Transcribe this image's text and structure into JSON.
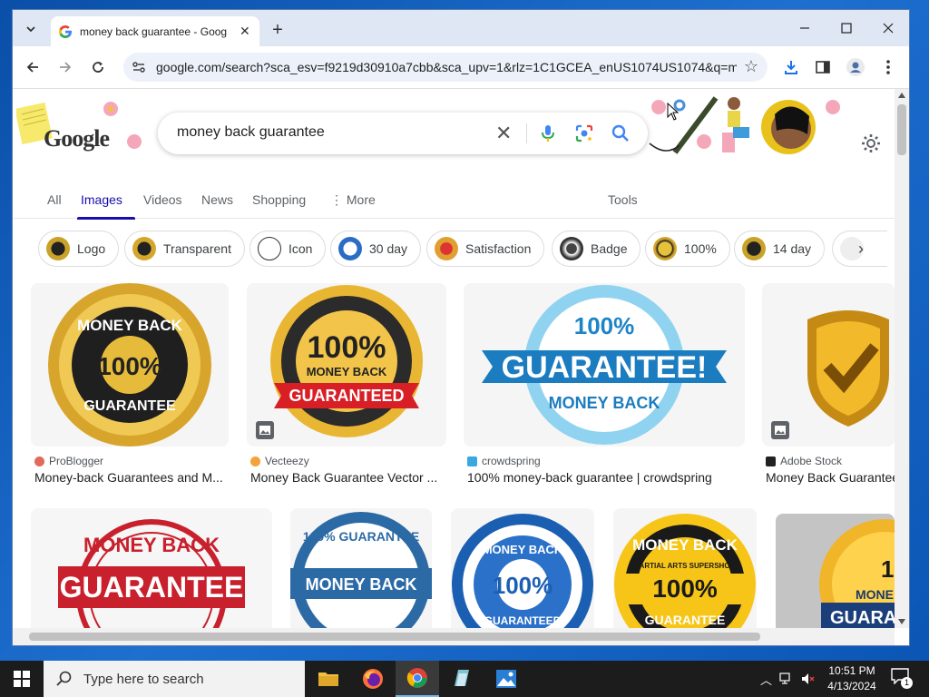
{
  "browser": {
    "tab_title": "money back guarantee - Goog",
    "url": "google.com/search?sca_esv=f9219d30910a7cbb&sca_upv=1&rlz=1C1GCEA_enUS1074US1074&q=m..."
  },
  "google": {
    "logo_text": "Google",
    "query": "money back guarantee",
    "tabs": [
      {
        "label": "All"
      },
      {
        "label": "Images"
      },
      {
        "label": "Videos"
      },
      {
        "label": "News"
      },
      {
        "label": "Shopping"
      },
      {
        "label": "More"
      }
    ],
    "tools_label": "Tools",
    "chips": [
      {
        "label": "Logo"
      },
      {
        "label": "Transparent"
      },
      {
        "label": "Icon"
      },
      {
        "label": "30 day"
      },
      {
        "label": "Satisfaction"
      },
      {
        "label": "Badge"
      },
      {
        "label": "100%"
      },
      {
        "label": "14 day"
      }
    ],
    "results_row1": [
      {
        "source": "ProBlogger",
        "title": "Money-back Guarantees and M...",
        "image_text": "MONEY BACK 100% GUARANTEE"
      },
      {
        "source": "Vecteezy",
        "title": "Money Back Guarantee Vector ...",
        "image_text_top": "100%",
        "image_text_mid": "MONEY BACK",
        "image_text_ribbon": "GUARANTEED"
      },
      {
        "source": "crowdspring",
        "title": "100% money-back guarantee | crowdspring",
        "image_text_top": "100%",
        "image_text_mid": "GUARANTEE!",
        "image_text_bottom": "MONEY BACK"
      },
      {
        "source": "Adobe Stock",
        "title": "Money Back Guarantee"
      }
    ],
    "results_row2": [
      {
        "image_text_top": "MONEY BACK",
        "image_text_mid": "GUARANTEE"
      },
      {
        "image_text_top": "100% GUARANTEE",
        "image_text_mid": "MONEY BACK"
      },
      {
        "image_text_top": "MONEY BACK",
        "image_text_mid": "100%",
        "image_text_bottom": "GUARANTEED"
      },
      {
        "image_text_top": "MONEY BACK",
        "image_text_sub": "MARTIAL ARTS SUPERSHOW",
        "image_text_mid": "100%",
        "image_text_bottom": "GUARANTEE"
      },
      {
        "image_text_top": "10",
        "image_text_mid": "MONE",
        "image_text_bottom": "GUARA"
      }
    ]
  },
  "taskbar": {
    "search_placeholder": "Type here to search",
    "time": "10:51 PM",
    "date": "4/13/2024",
    "notification_count": "1"
  },
  "colors": {
    "google_blue": "#1a0dab",
    "desktop": "#1565c0",
    "taskbar": "#1c1c1c"
  }
}
